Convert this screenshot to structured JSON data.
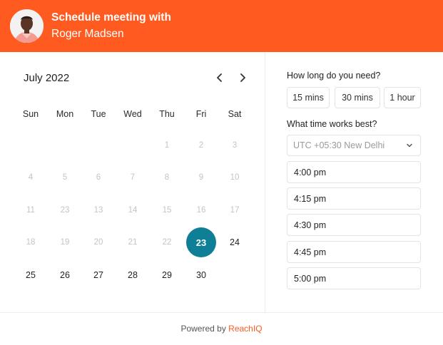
{
  "header": {
    "title": "Schedule meeting with",
    "name": "Roger Madsen",
    "color": "#ff5a1f"
  },
  "calendar": {
    "month_label": "July 2022",
    "weekdays": [
      "Sun",
      "Mon",
      "Tue",
      "Wed",
      "Thu",
      "Fri",
      "Sat"
    ],
    "days": [
      {
        "label": "1",
        "state": "disabled"
      },
      {
        "label": "2",
        "state": "disabled"
      },
      {
        "label": "3",
        "state": "disabled"
      },
      {
        "label": "4",
        "state": "disabled"
      },
      {
        "label": "5",
        "state": "disabled"
      },
      {
        "label": "6",
        "state": "disabled"
      },
      {
        "label": "7",
        "state": "disabled"
      },
      {
        "label": "8",
        "state": "disabled"
      },
      {
        "label": "9",
        "state": "disabled"
      },
      {
        "label": "10",
        "state": "disabled"
      },
      {
        "label": "11",
        "state": "disabled"
      },
      {
        "label": "23",
        "state": "disabled"
      },
      {
        "label": "13",
        "state": "disabled"
      },
      {
        "label": "14",
        "state": "disabled"
      },
      {
        "label": "15",
        "state": "disabled"
      },
      {
        "label": "16",
        "state": "disabled"
      },
      {
        "label": "17",
        "state": "disabled"
      },
      {
        "label": "18",
        "state": "disabled"
      },
      {
        "label": "19",
        "state": "disabled"
      },
      {
        "label": "20",
        "state": "disabled"
      },
      {
        "label": "21",
        "state": "disabled"
      },
      {
        "label": "22",
        "state": "disabled"
      },
      {
        "label": "23",
        "state": "selected"
      },
      {
        "label": "24",
        "state": "active"
      },
      {
        "label": "25",
        "state": "active"
      },
      {
        "label": "26",
        "state": "active"
      },
      {
        "label": "27",
        "state": "active"
      },
      {
        "label": "28",
        "state": "active"
      },
      {
        "label": "29",
        "state": "active"
      },
      {
        "label": "30",
        "state": "active"
      }
    ],
    "first_weekday_index": 4,
    "selected_color": "#0e7f97"
  },
  "duration": {
    "label": "How long do you need?",
    "options": [
      "15 mins",
      "30 mins",
      "1 hour"
    ]
  },
  "time": {
    "label": "What time works best?",
    "timezone": "UTC +05:30 New Delhi",
    "slots": [
      "4:00 pm",
      "4:15 pm",
      "4:30 pm",
      "4:45 pm",
      "5:00 pm"
    ]
  },
  "footer": {
    "prefix": "Powered by",
    "brand": "ReachIQ"
  }
}
